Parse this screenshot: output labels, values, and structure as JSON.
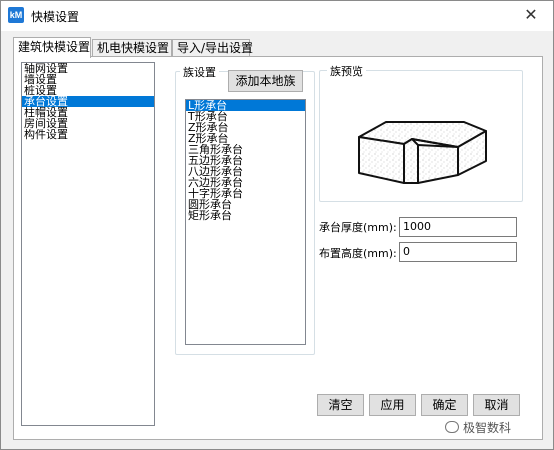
{
  "window": {
    "title": "快模设置",
    "app_icon_text": "kM",
    "close_glyph": "✕"
  },
  "tabs": [
    {
      "label": "建筑快模设置",
      "active": true
    },
    {
      "label": "机电快模设置",
      "active": false
    },
    {
      "label": "导入/导出设置",
      "active": false
    }
  ],
  "category_list": {
    "items": [
      "轴网设置",
      "墙设置",
      "桩设置",
      "承台设置",
      "柱帽设置",
      "房间设置",
      "构件设置"
    ],
    "selected_index": 3
  },
  "family_group": {
    "label": "族设置",
    "add_button": "添加本地族",
    "items": [
      "L形承台",
      "T形承台",
      "Z形承台",
      "Z形承台",
      "三角形承台",
      "五边形承台",
      "八边形承台",
      "六边形承台",
      "十字形承台",
      "圆形承台",
      "矩形承台"
    ],
    "selected_index": 0
  },
  "preview_group": {
    "label": "族预览"
  },
  "fields": {
    "thickness_label": "承台厚度(mm):",
    "thickness_value": "1000",
    "height_label": "布置高度(mm):",
    "height_value": "0"
  },
  "buttons": {
    "clear": "清空",
    "apply": "应用",
    "ok": "确定",
    "cancel": "取消"
  },
  "watermark": {
    "text": "极智数科"
  }
}
